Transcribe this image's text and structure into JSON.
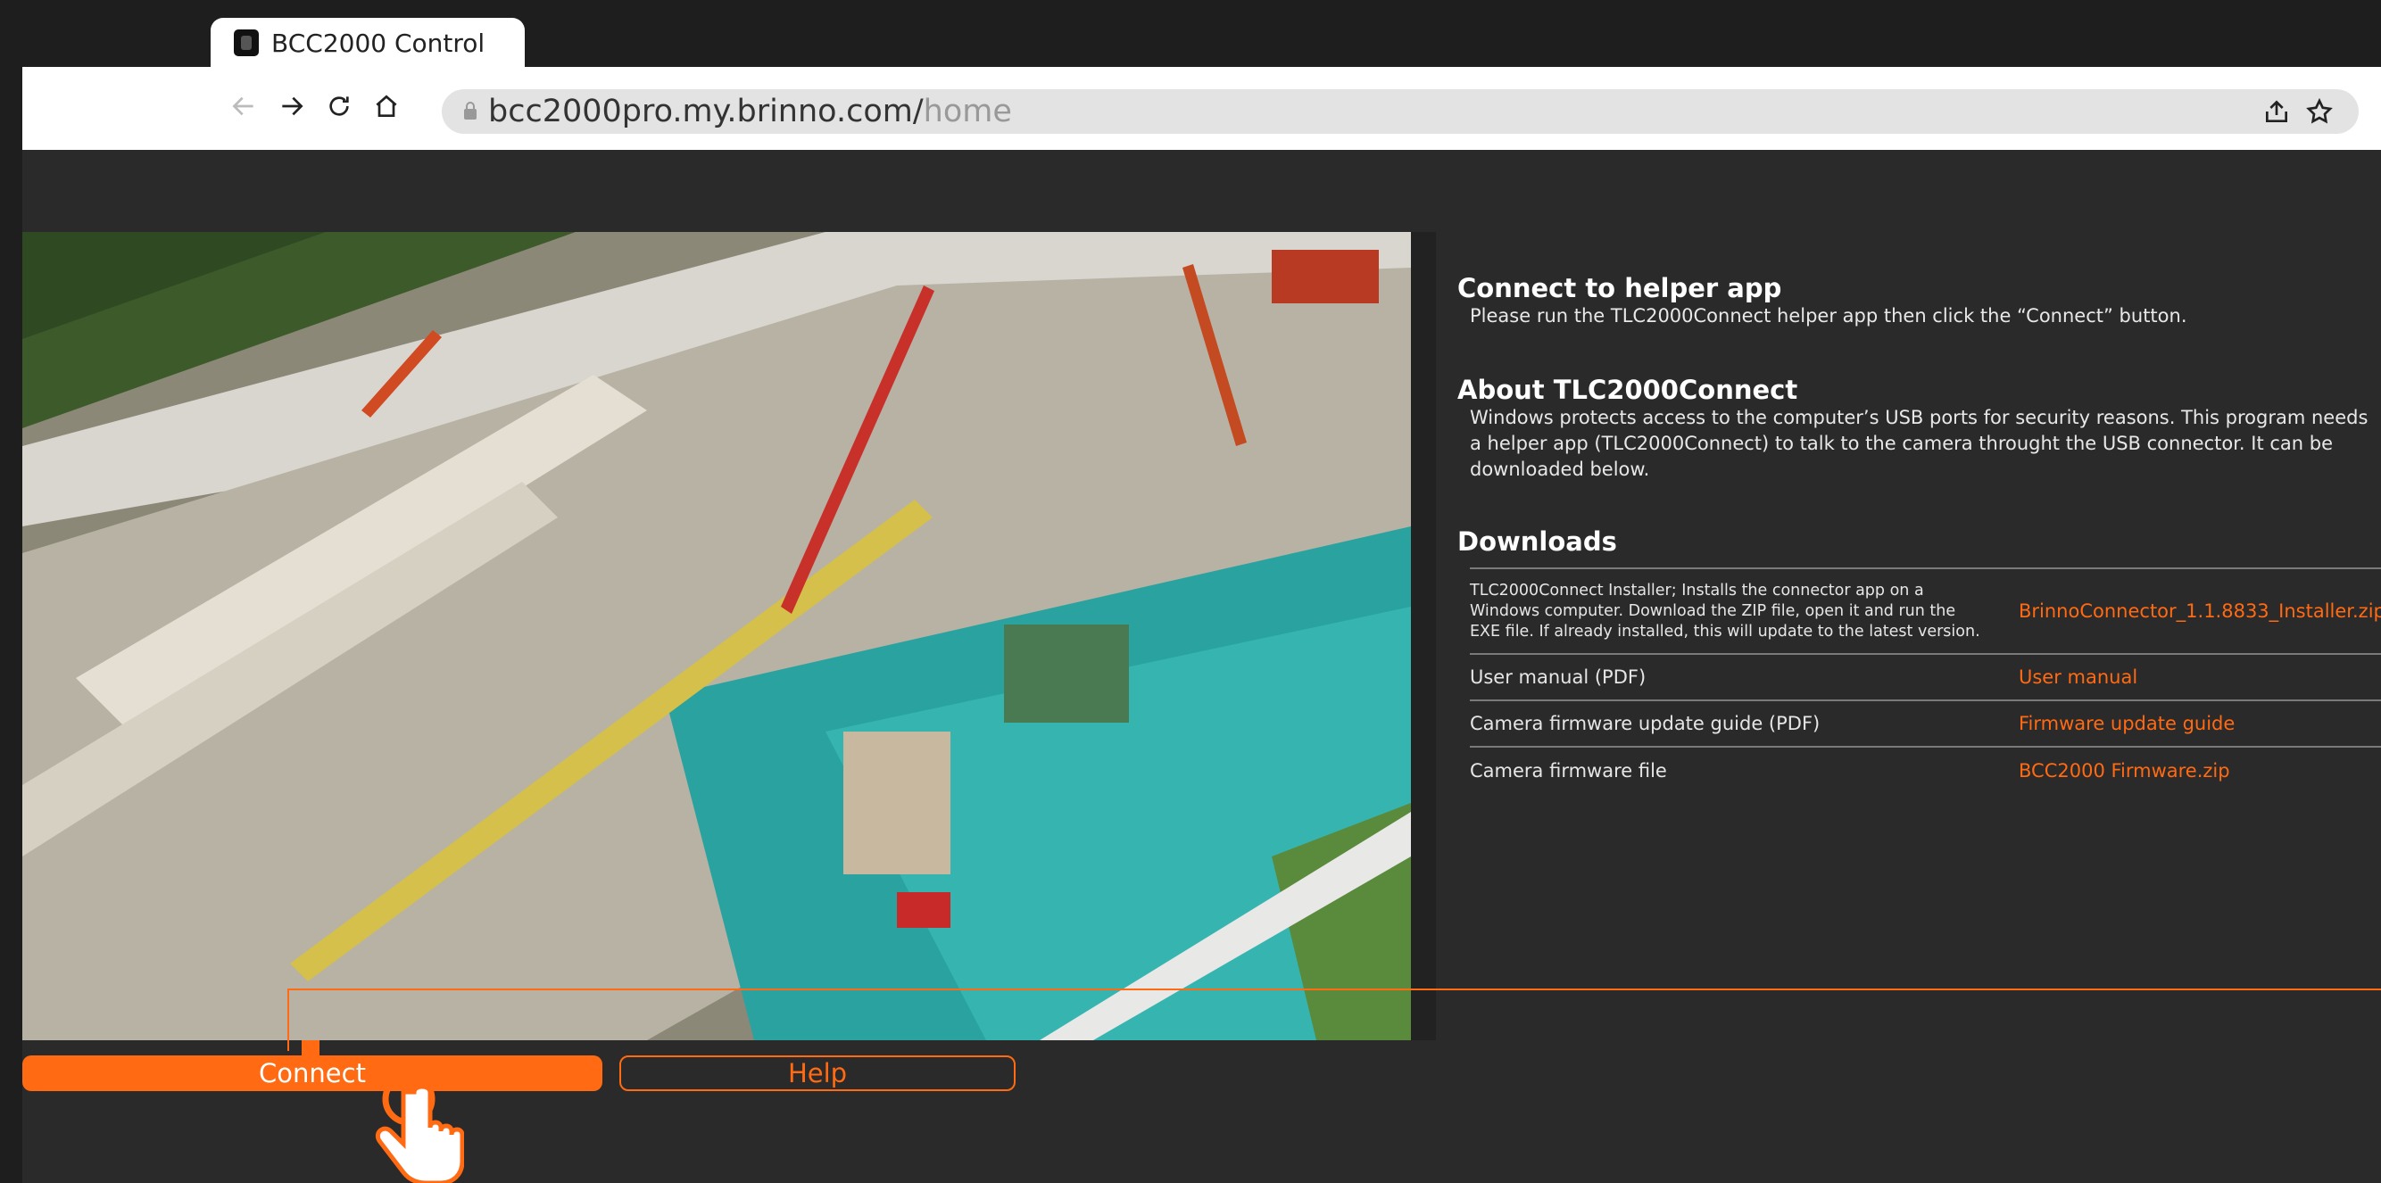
{
  "browser": {
    "tab_title": "BCC2000 Control",
    "url_host": "bcc2000pro.my.brinno.com/",
    "url_path": "home"
  },
  "sections": {
    "connect": {
      "heading": "Connect to helper app",
      "text": "Please run the TLC2000Connect helper app then click the “Connect” button."
    },
    "about": {
      "heading": "About TLC2000Connect",
      "text": "Windows protects access to the computer’s USB ports for security reasons. This program needs\na helper app (TLC2000Connect) to talk to the camera throught the USB connector. It can be\ndownloaded below."
    },
    "downloads": {
      "heading": "Downloads",
      "rows": [
        {
          "description": "TLC2000Connect Installer; Installs the connector app on a\nWindows computer. Download the ZIP file, open it and run the\nEXE file. If already installed, this will update to the latest version.",
          "link": "BrinnoConnector_1.1.8833_Installer.zip"
        },
        {
          "description": "User manual (PDF)",
          "link": "User manual"
        },
        {
          "description": "Camera firmware update guide (PDF)",
          "link": "Firmware update guide"
        },
        {
          "description": "Camera firmware file",
          "link": "BCC2000 Firmware.zip"
        }
      ]
    }
  },
  "buttons": {
    "connect": "Connect",
    "help": "Help"
  },
  "colors": {
    "accent": "#ff6a13",
    "page_bg": "#2a2a2a",
    "chrome_bg": "#1e1e1e"
  },
  "icons": [
    "camera-favicon",
    "back-arrow-icon",
    "forward-arrow-icon",
    "reload-icon",
    "home-icon",
    "lock-icon",
    "share-icon",
    "star-icon",
    "hand-pointer-icon"
  ]
}
